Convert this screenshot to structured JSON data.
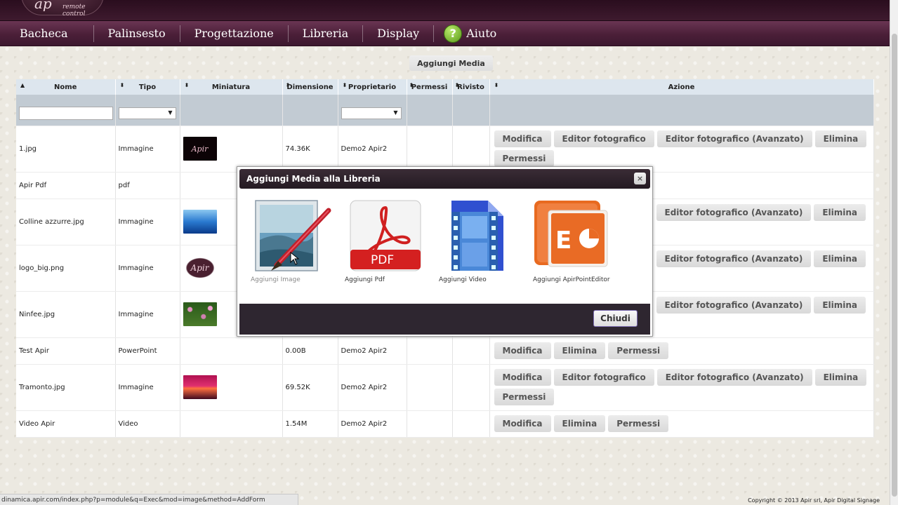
{
  "header": {
    "logo_mark": "ap",
    "logo_sub": "remote control",
    "nav": [
      "Bacheca",
      "Palinsesto",
      "Progettazione",
      "Libreria",
      "Display",
      "Aiuto"
    ],
    "help_glyph": "?"
  },
  "toolbar": {
    "add_media_label": "Aggiungi Media"
  },
  "table": {
    "columns": [
      "Nome",
      "Tipo",
      "Miniatura",
      "Dimensione",
      "Proprietario",
      "Permessi",
      "Rivisto",
      "Azione"
    ],
    "sort_up": "▲",
    "sort_both": "⬍",
    "select_arrow": "▼",
    "rows": [
      {
        "name": "1.jpg",
        "type": "Immagine",
        "thumb": "apir",
        "thumb_text": "Apir",
        "size": "74.36K",
        "owner": "Demo2 Apir2",
        "actions": [
          "Modifica",
          "Editor fotografico",
          "Editor fotografico (Avanzato)",
          "Elimina",
          "Permessi"
        ]
      },
      {
        "name": "Apir Pdf",
        "type": "pdf",
        "thumb": "",
        "thumb_text": "",
        "size": "",
        "owner": "",
        "actions": []
      },
      {
        "name": "Colline azzurre.jpg",
        "type": "Immagine",
        "thumb": "hills",
        "thumb_text": "",
        "size": "",
        "owner": "",
        "actions": [
          "Editor fotografico (Avanzato)",
          "Elimina"
        ]
      },
      {
        "name": "logo_big.png",
        "type": "Immagine",
        "thumb": "logo",
        "thumb_text": "Apir",
        "size": "",
        "owner": "",
        "actions": [
          "Editor fotografico (Avanzato)",
          "Elimina"
        ]
      },
      {
        "name": "Ninfee.jpg",
        "type": "Immagine",
        "thumb": "flowers",
        "thumb_text": "",
        "size": "",
        "owner": "",
        "actions": [
          "Editor fotografico (Avanzato)",
          "Elimina"
        ]
      },
      {
        "name": "Test Apir",
        "type": "PowerPoint",
        "thumb": "",
        "thumb_text": "",
        "size": "0.00B",
        "owner": "Demo2 Apir2",
        "actions": [
          "Modifica",
          "Elimina",
          "Permessi"
        ]
      },
      {
        "name": "Tramonto.jpg",
        "type": "Immagine",
        "thumb": "sunset",
        "thumb_text": "",
        "size": "69.52K",
        "owner": "Demo2 Apir2",
        "actions": [
          "Modifica",
          "Editor fotografico",
          "Editor fotografico (Avanzato)",
          "Elimina",
          "Permessi"
        ]
      },
      {
        "name": "Video Apir",
        "type": "Video",
        "thumb": "",
        "thumb_text": "",
        "size": "1.54M",
        "owner": "Demo2 Apir2",
        "actions": [
          "Modifica",
          "Elimina",
          "Permessi"
        ]
      }
    ]
  },
  "modal": {
    "title": "Aggiungi Media alla Libreria",
    "close_glyph": "×",
    "options": [
      {
        "label": "Aggiungi Image",
        "icon": "image-editor-icon"
      },
      {
        "label": "Aggiungi Pdf",
        "icon": "pdf-icon",
        "icon_text": "PDF"
      },
      {
        "label": "Aggiungi Video",
        "icon": "video-file-icon"
      },
      {
        "label": "Aggiungi ApirPointEditor",
        "icon": "powerpoint-icon"
      }
    ],
    "close_label": "Chiudi"
  },
  "status": {
    "url": "dinamica.apir.com/index.php?p=module&q=Exec&mod=image&method=AddForm",
    "copyright": "Copyright © 2013 Apir srl, Apir Digital Signage"
  },
  "colors": {
    "nav": "#4b1f38",
    "header_row": "#dde6ee",
    "filter_row": "#c2cbd3",
    "modal_title": "#2e2630"
  }
}
